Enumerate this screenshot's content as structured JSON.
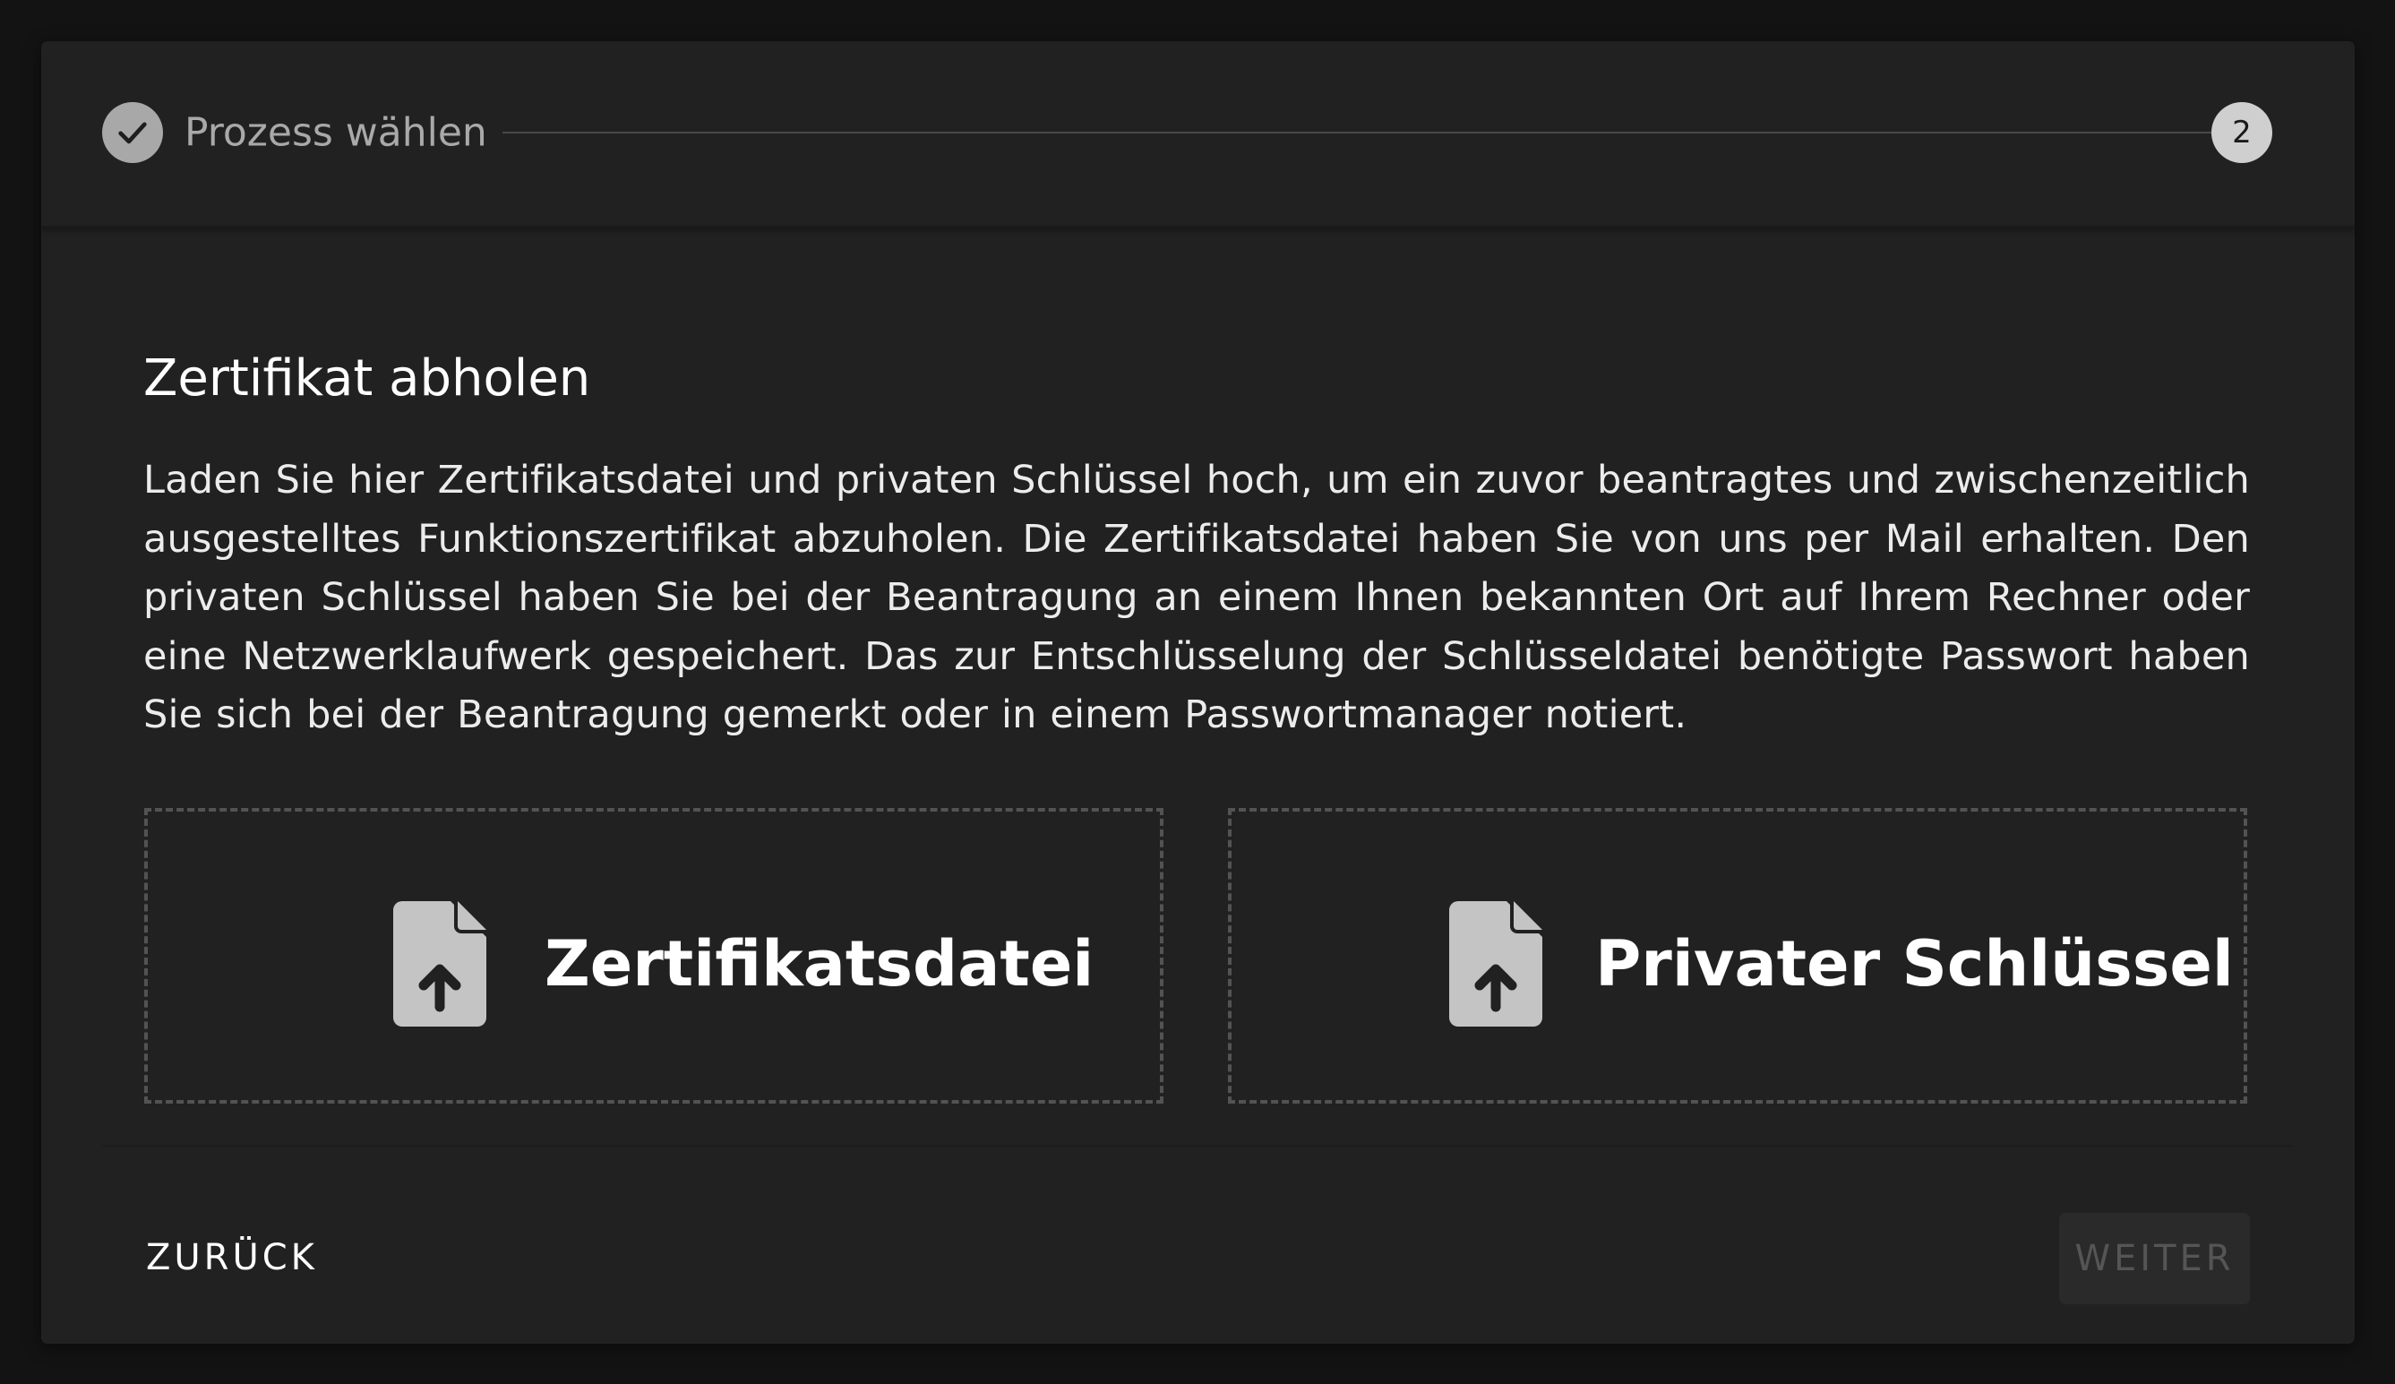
{
  "stepper": {
    "step1_label": "Prozess wählen",
    "step2_number": "2"
  },
  "main": {
    "title": "Zertifikat abholen",
    "description": "Laden Sie hier Zertifikatsdatei und privaten Schlüssel hoch, um ein zuvor beantragtes und zwischenzeit­lich ausgestelltes Funktionszertifikat abzuholen. Die Zertifikatsdatei haben Sie von uns per Mail erhalten. Den privaten Schlüssel haben Sie bei der Beantragung an einem Ihnen bekannten Ort auf Ihrem Rechner oder eine Netzwerklaufwerk gespeichert. Das zur Entschlüsselung der Schlüsseldatei benötigte Passwort haben Sie sich bei der Beantragung gemerkt oder in einem Passwortmanager notiert.",
    "uploads": [
      {
        "label": "Zertifikatsdatei",
        "icon": "file-upload-icon"
      },
      {
        "label": "Privater Schlüssel",
        "icon": "file-upload-icon"
      }
    ]
  },
  "footer": {
    "back_label": "ZURÜCK",
    "next_label": "WEITER"
  },
  "colors": {
    "background": "#131313",
    "dialog": "#212121",
    "text": "#ffffff",
    "disabled_text": "#555555"
  }
}
